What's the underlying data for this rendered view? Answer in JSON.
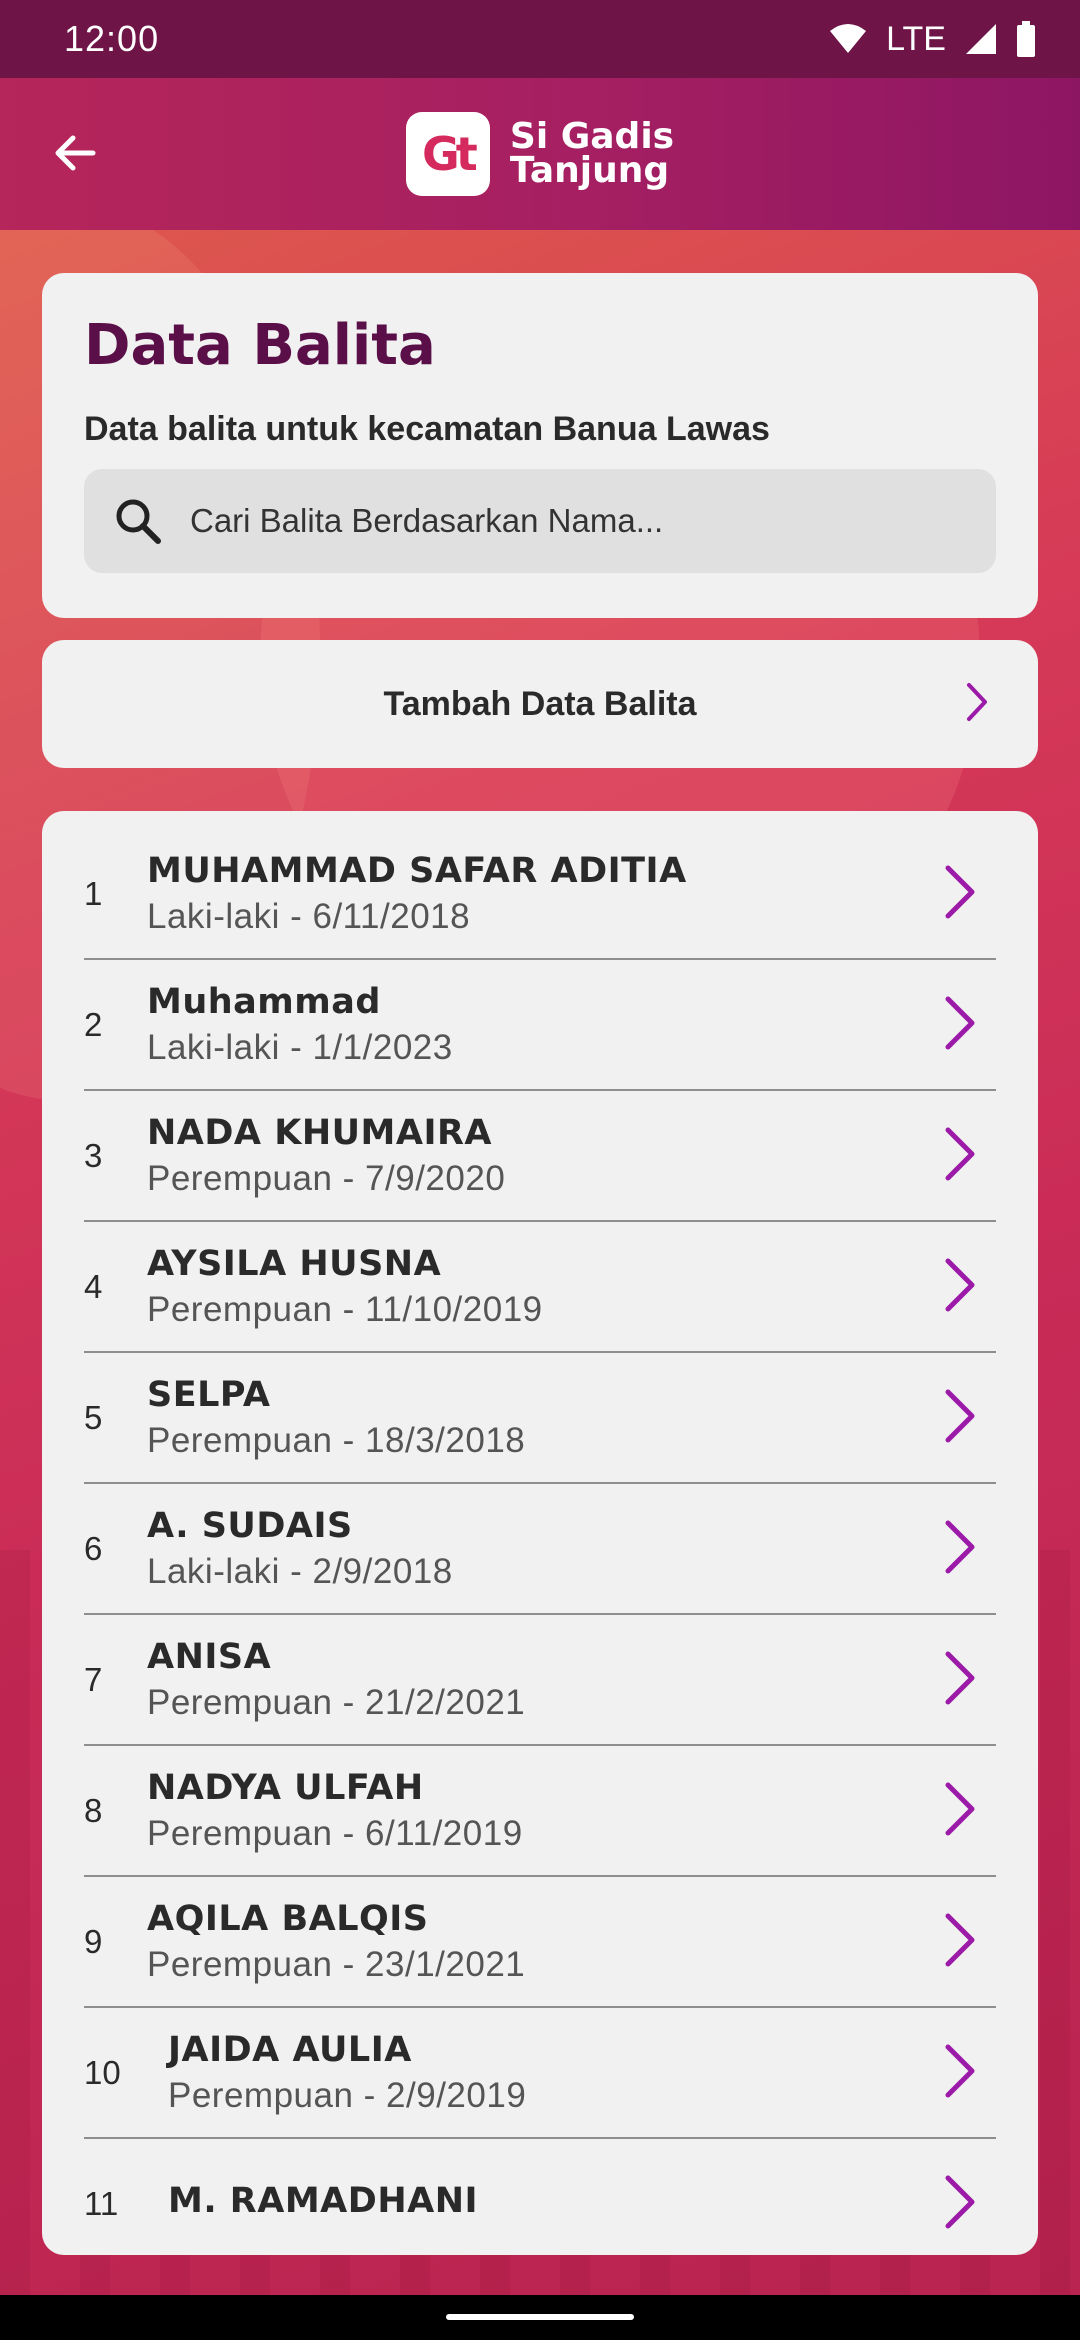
{
  "status_bar": {
    "time": "12:00",
    "network": "LTE"
  },
  "header": {
    "logo_badge": "Gt",
    "logo_line1": "Si Gadis",
    "logo_line2": "Tanjung"
  },
  "page": {
    "title": "Data Balita",
    "subtitle": "Data balita untuk kecamatan Banua Lawas",
    "search_placeholder": "Cari Balita Berdasarkan Nama..."
  },
  "add_button": {
    "label": "Tambah Data Balita"
  },
  "list": [
    {
      "num": "1",
      "name": "MUHAMMAD SAFAR ADITIA",
      "sub": "Laki-laki - 6/11/2018"
    },
    {
      "num": "2",
      "name": "Muhammad",
      "sub": "Laki-laki - 1/1/2023"
    },
    {
      "num": "3",
      "name": "NADA KHUMAIRA",
      "sub": "Perempuan - 7/9/2020"
    },
    {
      "num": "4",
      "name": "AYSILA HUSNA",
      "sub": "Perempuan - 11/10/2019"
    },
    {
      "num": "5",
      "name": "SELPA",
      "sub": "Perempuan - 18/3/2018"
    },
    {
      "num": "6",
      "name": "A. SUDAIS",
      "sub": "Laki-laki - 2/9/2018"
    },
    {
      "num": "7",
      "name": "ANISA",
      "sub": "Perempuan - 21/2/2021"
    },
    {
      "num": "8",
      "name": "NADYA ULFAH",
      "sub": "Perempuan - 6/11/2019"
    },
    {
      "num": "9",
      "name": "AQILA BALQIS",
      "sub": "Perempuan - 23/1/2021"
    },
    {
      "num": "10",
      "name": "JAIDA AULIA",
      "sub": "Perempuan - 2/9/2019"
    },
    {
      "num": "11",
      "name": "M. RAMADHANI",
      "sub": ""
    }
  ],
  "colors": {
    "accent": "#9c1aa8",
    "title": "#5a0f48",
    "status_bar": "#6e1447"
  },
  "icons": {
    "back": "arrow-left-icon",
    "search": "search-icon",
    "chevron": "chevron-right-icon"
  }
}
